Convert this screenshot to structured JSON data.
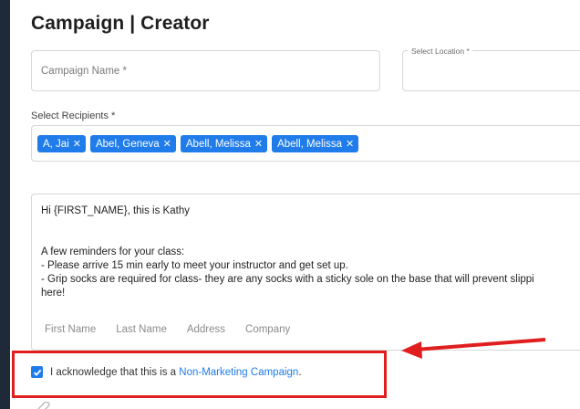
{
  "header": {
    "title": "Campaign | Creator"
  },
  "form": {
    "campaign_name_placeholder": "Campaign Name *",
    "location_label": "Select Location *",
    "recipients_label": "Select Recipients *",
    "recipients": [
      {
        "label": "A, Jai"
      },
      {
        "label": "Abel, Geneva"
      },
      {
        "label": "Abell, Melissa"
      },
      {
        "label": "Abell, Melissa"
      }
    ],
    "message_lines": [
      "Hi {FIRST_NAME}, this is Kathy",
      "",
      "A few reminders for your class:",
      "- Please arrive 15 min early to meet your instructor and get set up.",
      "- Grip socks are required for class- they are any socks with a sticky sole on the base that will prevent slippi",
      "here!"
    ],
    "tokens": [
      "First Name",
      "Last Name",
      "Address",
      "Company"
    ],
    "ack_text": "I acknowledge that this is a ",
    "ack_link": "Non-Marketing Campaign",
    "ack_suffix": "."
  },
  "colors": {
    "accent": "#1f7cea",
    "highlight": "#e01e1e",
    "sidebar": "#1e2a38"
  }
}
